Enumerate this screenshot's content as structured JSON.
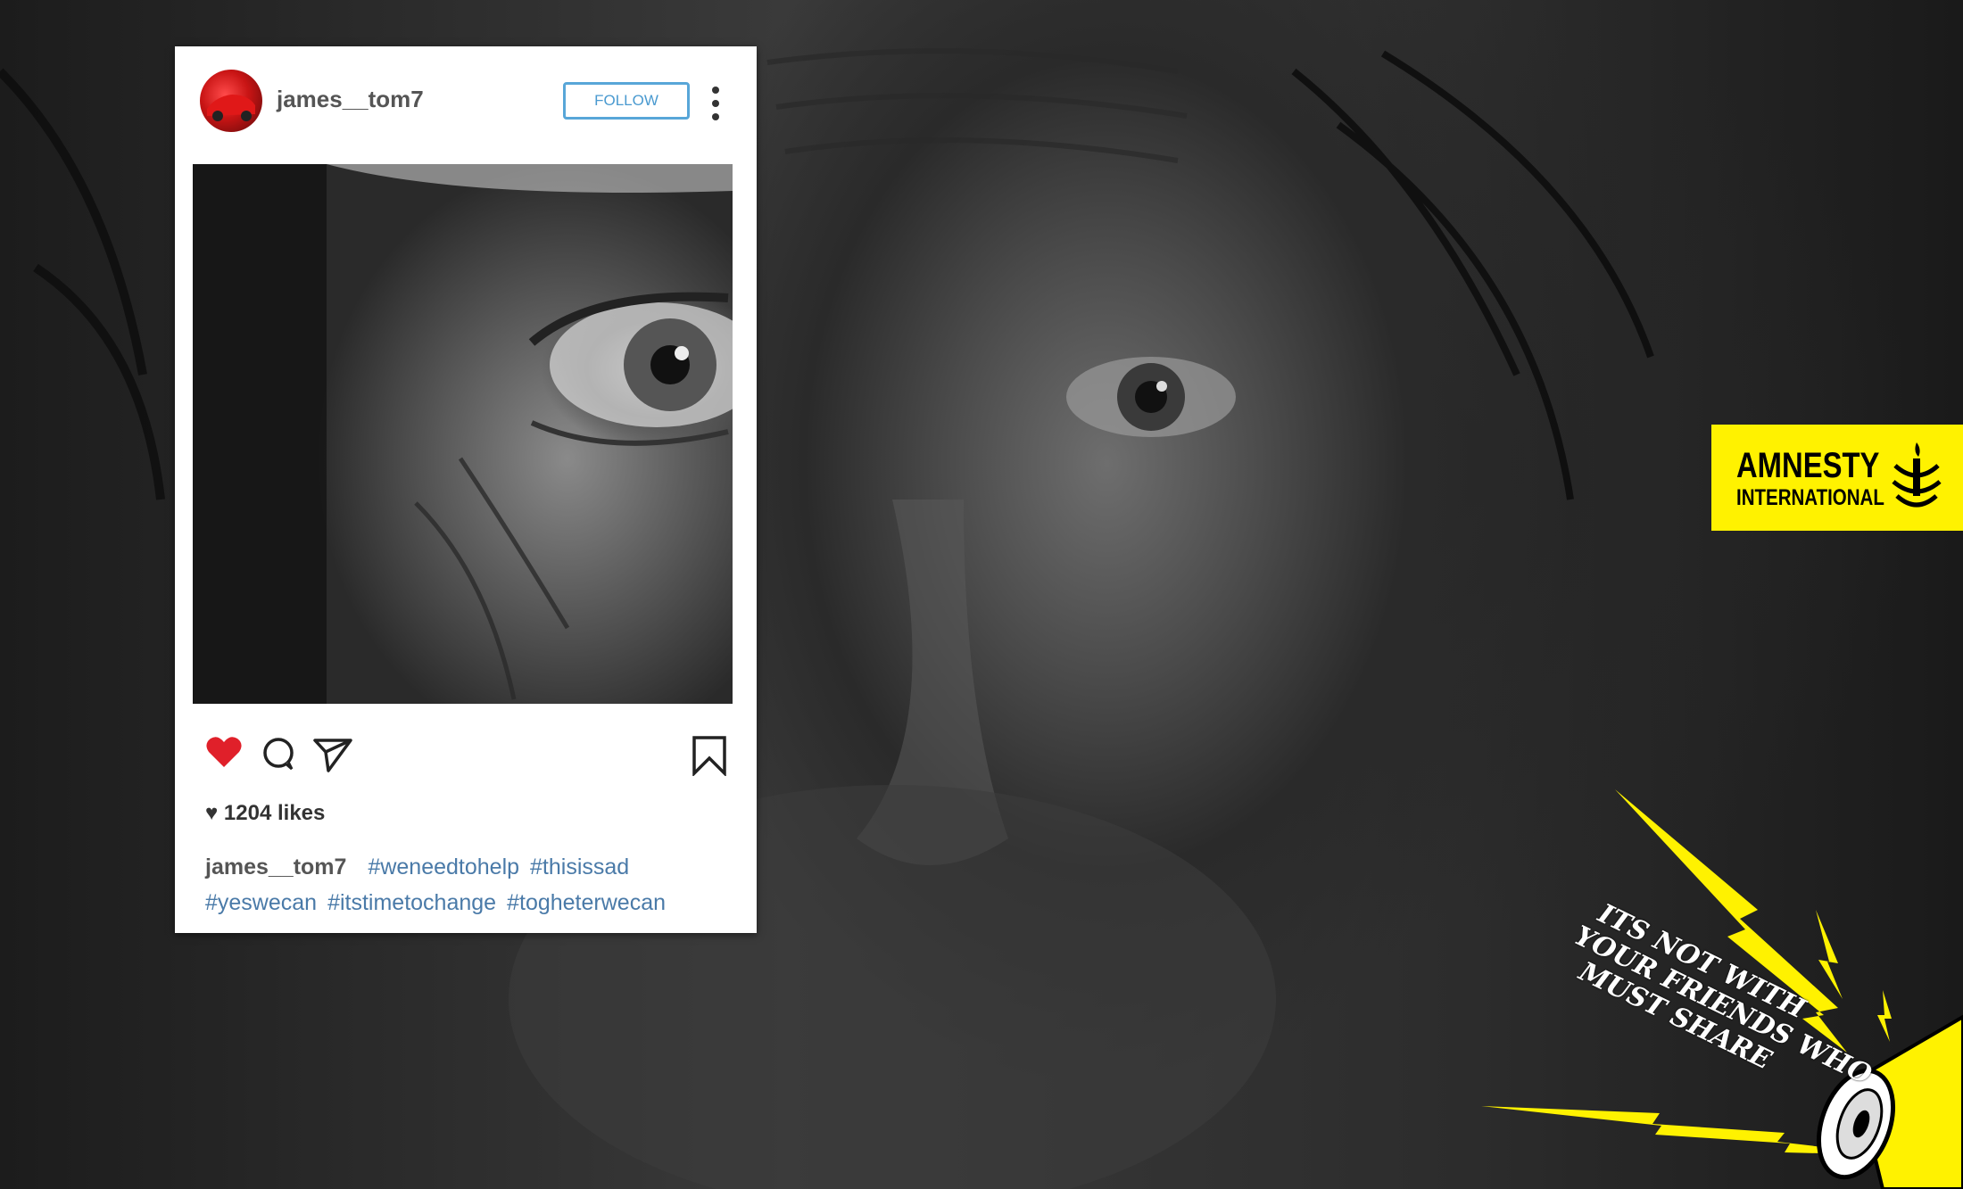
{
  "post": {
    "username": "james__tom7",
    "follow_label": "FOLLOW",
    "likes": "1204 likes",
    "caption_user": "james__tom7",
    "hashtags": [
      "#weneedtohelp",
      "#thisissad",
      "#yeswecan",
      "#itstimetochange",
      "#togheterwecan"
    ]
  },
  "logo": {
    "line1": "AMNESTY",
    "line2": "INTERNATIONAL",
    "color": "#fff200"
  },
  "slogan": {
    "lines": [
      "ITS NOT WITH",
      "YOUR FRIENDS WHO",
      "MUST SHARE"
    ]
  },
  "colors": {
    "heart": "#e0202a",
    "follow_border": "#58a6d8",
    "hashtag": "#4a7aa8",
    "lightning": "#fff200"
  },
  "icons": [
    "heart-icon",
    "comment-icon",
    "share-icon",
    "bookmark-icon",
    "more-icon",
    "candle-icon",
    "megaphone-icon"
  ]
}
